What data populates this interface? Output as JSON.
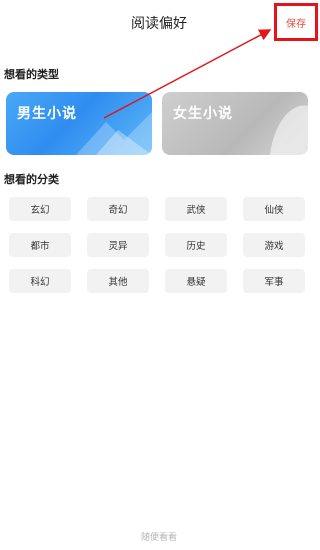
{
  "header": {
    "title": "阅读偏好",
    "save_label": "保存"
  },
  "sections": {
    "types_title": "想看的类型",
    "categories_title": "想看的分类"
  },
  "types": [
    {
      "label": "男生小说",
      "selected": true
    },
    {
      "label": "女生小说",
      "selected": false
    }
  ],
  "categories": [
    "玄幻",
    "奇幻",
    "武侠",
    "仙侠",
    "都市",
    "灵异",
    "历史",
    "游戏",
    "科幻",
    "其他",
    "悬疑",
    "军事"
  ],
  "footer": {
    "browse_label": "随便看看"
  },
  "colors": {
    "annotation_red": "#e3141b",
    "save_text": "#e54b3c",
    "male_card": "#2f8df0",
    "female_card": "#bdbdbd"
  }
}
